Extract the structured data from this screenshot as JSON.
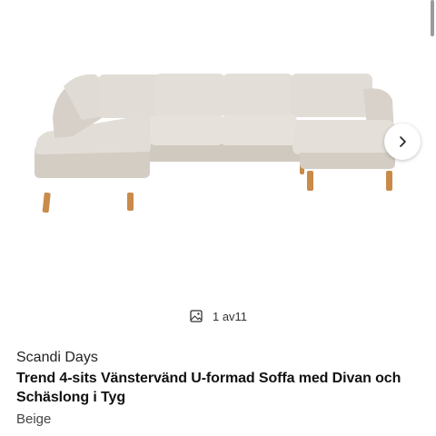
{
  "gallery": {
    "image_alt": "Beige U-formad soffa",
    "next_icon": "chevron-right-icon",
    "counter_icon": "image-icon",
    "current": "1",
    "separator": "av",
    "total": "11"
  },
  "product": {
    "brand": "Scandi Days",
    "title": "Trend 4-sits Vänstervänd U-formad Soffa med Divan och Schäslong i Tyg",
    "color": "Beige"
  },
  "colors": {
    "fabric": "#ddd8d0",
    "fabric_shadow": "#cfc9c0",
    "legs": "#c98a4a"
  }
}
